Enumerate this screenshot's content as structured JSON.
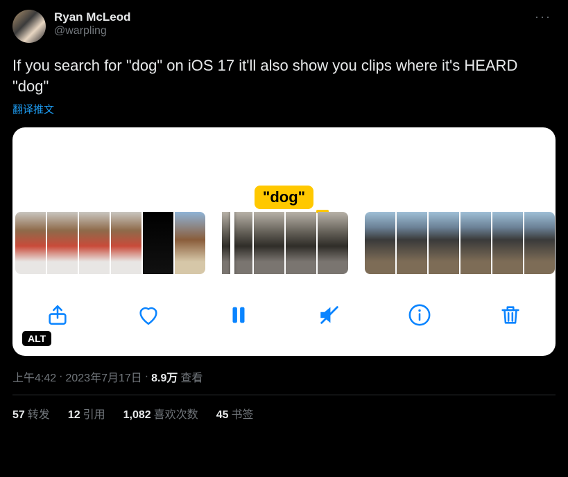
{
  "author": {
    "display_name": "Ryan McLeod",
    "handle": "@warpling"
  },
  "more_glyph": "···",
  "body": "If you search for \"dog\" on iOS 17 it'll also show you clips where it's HEARD \"dog\"",
  "translate_label": "翻译推文",
  "media": {
    "search_token": "\"dog\"",
    "alt_badge": "ALT",
    "toolbar": {
      "share_name": "share-icon",
      "like_name": "heart-icon",
      "pause_name": "pause-icon",
      "mute_name": "mute-icon",
      "info_name": "info-icon",
      "trash_name": "trash-icon"
    }
  },
  "meta": {
    "time": "上午4:42",
    "sep1": " · ",
    "date": "2023年7月17日",
    "sep2": " · ",
    "views_num": "8.9万",
    "views_label": " 查看"
  },
  "stats": {
    "retweets_num": "57",
    "retweets_label": "转发",
    "quotes_num": "12",
    "quotes_label": "引用",
    "likes_num": "1,082",
    "likes_label": "喜欢次数",
    "bookmarks_num": "45",
    "bookmarks_label": "书签"
  }
}
